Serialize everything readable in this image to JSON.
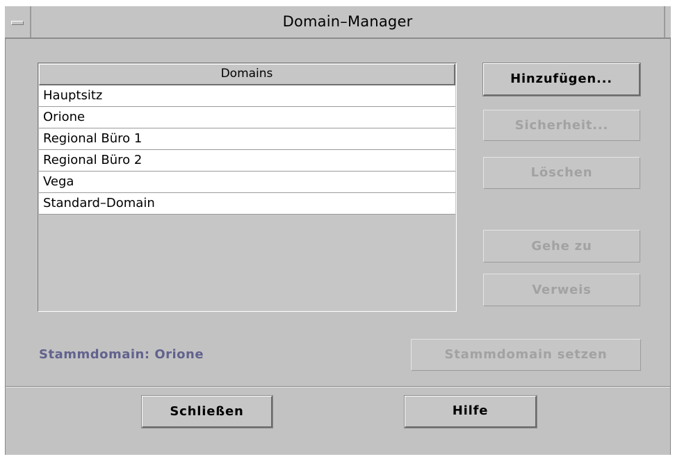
{
  "window": {
    "title": "Domain–Manager"
  },
  "domains_list": {
    "header": "Domains",
    "items": [
      "Hauptsitz",
      "Orione",
      "Regional Büro 1",
      "Regional Büro 2",
      "Vega",
      "Standard–Domain"
    ]
  },
  "buttons": {
    "add": "Hinzufügen...",
    "security": "Sicherheit...",
    "delete": "Löschen",
    "goto": "Gehe zu",
    "reference": "Verweis",
    "set_root": "Stammdomain setzen",
    "close": "Schließen",
    "help": "Hilfe"
  },
  "root_domain": {
    "text": "Stammdomain: Orione",
    "color": "#62628e"
  },
  "icons": {
    "window_menu": "window-menu-icon"
  },
  "colors": {
    "background": "#c2c2c2",
    "disabled_text": "#a2a2a2"
  }
}
